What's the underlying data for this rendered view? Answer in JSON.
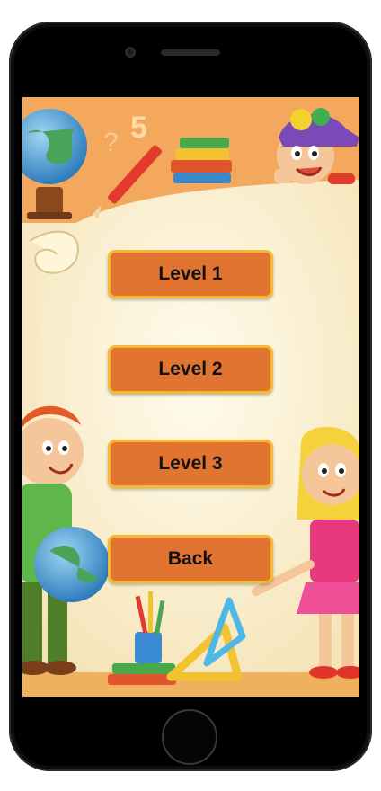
{
  "menu": {
    "buttons": [
      {
        "label": "Level 1"
      },
      {
        "label": "Level 2"
      },
      {
        "label": "Level 3"
      },
      {
        "label": "Back"
      }
    ]
  },
  "background": {
    "number_decoration": "5"
  },
  "colors": {
    "button_fill": "#e27432",
    "button_border": "#f4b92e",
    "background_orange": "#f2a45b",
    "paper": "#fbf3dc"
  }
}
